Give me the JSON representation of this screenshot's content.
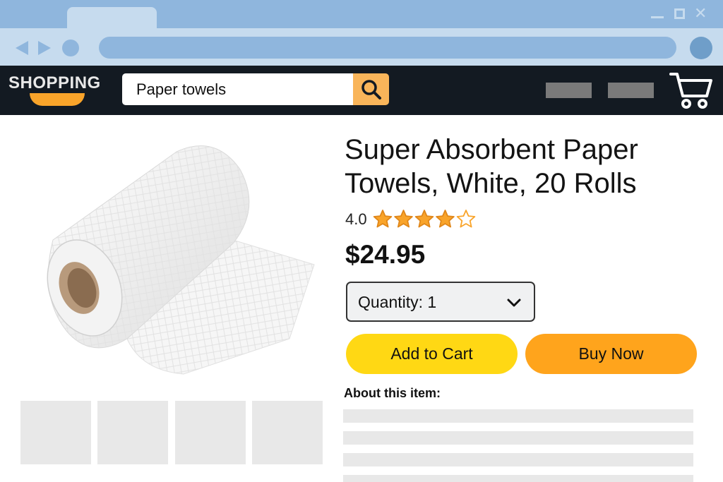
{
  "browser": {
    "window_controls": [
      "minimize",
      "maximize",
      "close"
    ]
  },
  "header": {
    "logo": "SHOPPING",
    "search_value": "Paper towels",
    "colors": {
      "header_bg": "#131a22",
      "search_button": "#f9b55a",
      "logo_accent": "#f9a42a"
    }
  },
  "product": {
    "title_line1": "Super Absorbent Paper",
    "title_line2": "Towels, White, 20 Rolls",
    "rating": "4.0",
    "rating_value": 4,
    "rating_max": 5,
    "price": "$24.95",
    "quantity_label": "Quantity: 1",
    "add_to_cart": "Add to Cart",
    "buy_now": "Buy Now",
    "about_heading": "About this item:"
  },
  "icons": {
    "search": "search-icon",
    "cart": "cart-icon",
    "chevron": "chevron-down-icon",
    "star_filled": "star-filled-icon",
    "star_empty": "star-empty-icon"
  },
  "colors": {
    "add_to_cart": "#ffd814",
    "buy_now": "#ffa41c",
    "star": "#f9a42a",
    "chrome": "#8fb6dd"
  }
}
